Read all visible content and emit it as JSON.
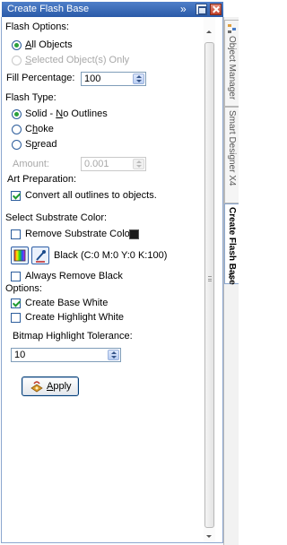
{
  "window": {
    "title": "Create Flash Base",
    "more_label": "»"
  },
  "flash_options": {
    "heading": "Flash Options:",
    "all_objects_pre": "",
    "all_objects_u": "A",
    "all_objects_post": "ll Objects",
    "selected_u": "S",
    "selected_post": "elected Object(s) Only",
    "fill_percentage_label": "Fill Percentage:",
    "fill_percentage_value": "100"
  },
  "flash_type": {
    "heading": "Flash Type:",
    "solid_pre": "Solid - ",
    "solid_u": "N",
    "solid_post": "o Outlines",
    "choke_pre": "C",
    "choke_u": "h",
    "choke_post": "oke",
    "spread_pre": "S",
    "spread_u": "p",
    "spread_post": "read",
    "amount_label": "Amount:",
    "amount_value": "0.001"
  },
  "art_preparation": {
    "heading": "Art Preparation:",
    "convert_label": "Convert all outlines to objects."
  },
  "substrate": {
    "heading": "Select Substrate Color:",
    "remove_label": "Remove Substrate Color",
    "swatch_color": "#1a1a1a",
    "color_value": "Black (C:0 M:0 Y:0 K:100)",
    "always_remove_label": "Always Remove Black"
  },
  "options": {
    "heading": "Options:",
    "base_white_label": "Create Base White",
    "highlight_white_label": "Create Highlight White",
    "tolerance_label": "Bitmap Highlight Tolerance:",
    "tolerance_value": "10"
  },
  "apply": {
    "label_u": "A",
    "label_post": "pply"
  },
  "side_tabs": {
    "object_manager": "Object Manager",
    "smart_designer": "Smart Designer X4",
    "create_flash_base": "Create Flash Base",
    "close": "×"
  },
  "colors": {
    "title_bar": "#2a5aa8",
    "check_green": "#1f9a2f",
    "border_blue": "#7f9db9"
  }
}
